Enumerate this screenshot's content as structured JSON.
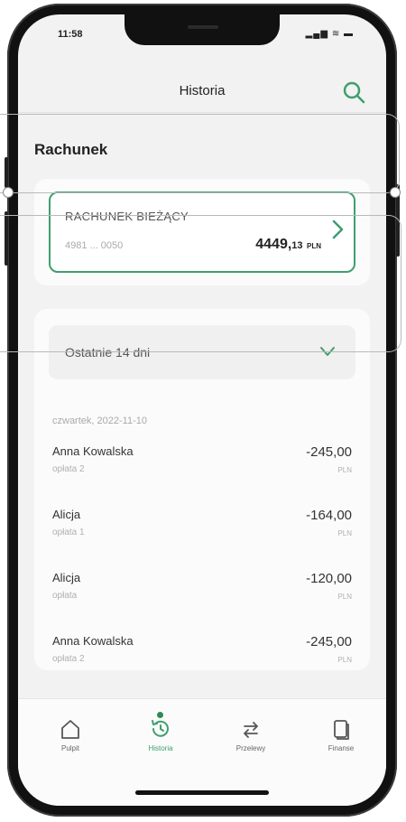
{
  "status": {
    "time": "11:58",
    "icons": "▂▄▆ ≋ ▬"
  },
  "header": {
    "title": "Historia"
  },
  "section": {
    "title": "Rachunek"
  },
  "account": {
    "name": "RACHUNEK BIEŻĄCY",
    "number": "4981 ... 0050",
    "balance_main": "4449,",
    "balance_decimal": "13",
    "currency": "PLN"
  },
  "filter": {
    "period": "Ostatnie 14 dni"
  },
  "history": {
    "date": "czwartek, 2022-11-10",
    "transactions": [
      {
        "name": "Anna Kowalska",
        "description": "opłata 2",
        "amount": "-245,00",
        "currency": "PLN"
      },
      {
        "name": "Alicja",
        "description": "opłata 1",
        "amount": "-164,00",
        "currency": "PLN"
      },
      {
        "name": "Alicja",
        "description": "opłata",
        "amount": "-120,00",
        "currency": "PLN"
      },
      {
        "name": "Anna Kowalska",
        "description": "opłata 2",
        "amount": "-245,00",
        "currency": "PLN"
      }
    ]
  },
  "tabs": [
    {
      "label": "Pulpit",
      "icon": "home-icon"
    },
    {
      "label": "Historia",
      "icon": "history-icon"
    },
    {
      "label": "Przelewy",
      "icon": "transfer-icon"
    },
    {
      "label": "Finanse",
      "icon": "finance-icon"
    }
  ],
  "colors": {
    "accent": "#3f9e6e",
    "background": "#f2f2f2",
    "card": "#fbfbfb"
  }
}
